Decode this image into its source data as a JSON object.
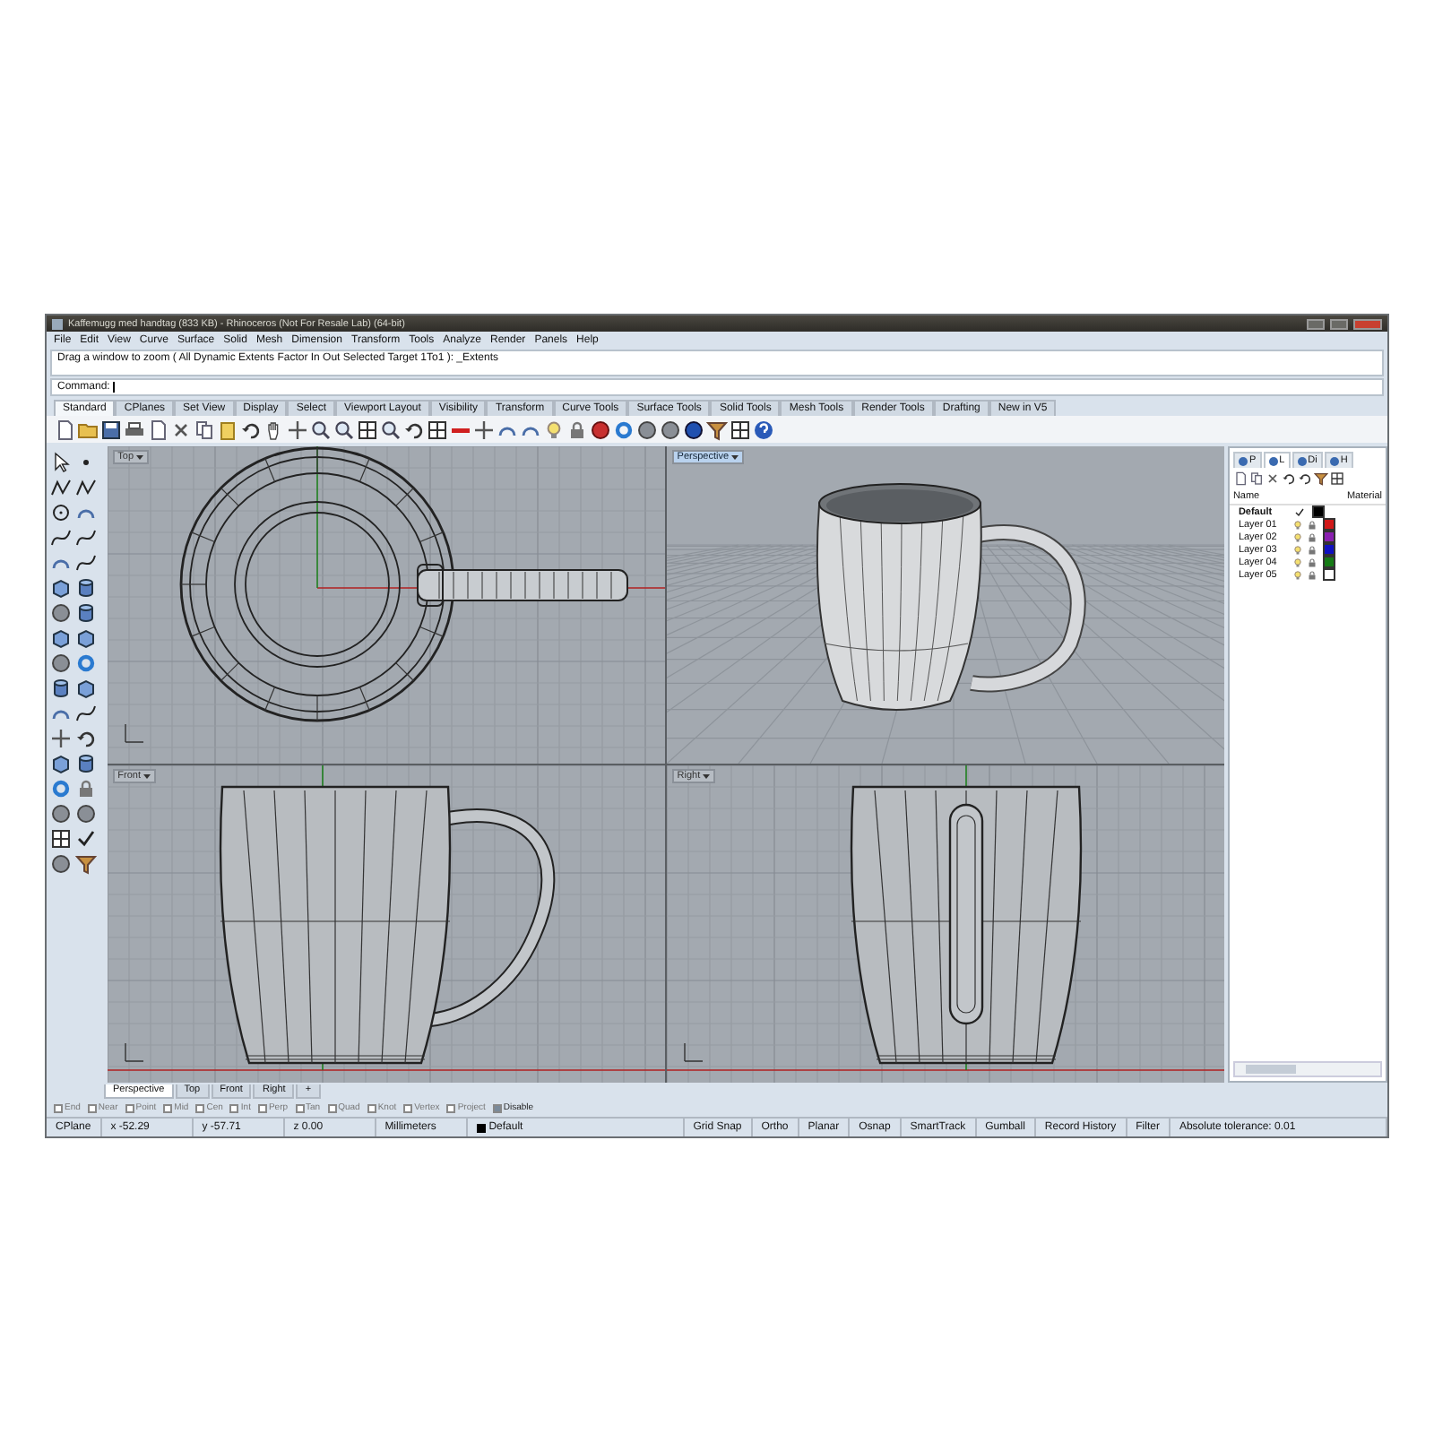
{
  "window": {
    "title": "Kaffemugg med handtag (833 KB) - Rhinoceros (Not For Resale Lab) (64-bit)"
  },
  "menu": [
    "File",
    "Edit",
    "View",
    "Curve",
    "Surface",
    "Solid",
    "Mesh",
    "Dimension",
    "Transform",
    "Tools",
    "Analyze",
    "Render",
    "Panels",
    "Help"
  ],
  "command_history": "Drag a window to zoom ( All Dynamic Extents Factor In Out Selected Target 1To1 ): _Extents",
  "command_prompt": "Command:",
  "toolbar_tabs": [
    {
      "label": "Standard",
      "selected": true
    },
    {
      "label": "CPlanes",
      "selected": false
    },
    {
      "label": "Set View",
      "selected": false
    },
    {
      "label": "Display",
      "selected": false
    },
    {
      "label": "Select",
      "selected": false
    },
    {
      "label": "Viewport Layout",
      "selected": false
    },
    {
      "label": "Visibility",
      "selected": false
    },
    {
      "label": "Transform",
      "selected": false
    },
    {
      "label": "Curve Tools",
      "selected": false
    },
    {
      "label": "Surface Tools",
      "selected": false
    },
    {
      "label": "Solid Tools",
      "selected": false
    },
    {
      "label": "Mesh Tools",
      "selected": false
    },
    {
      "label": "Render Tools",
      "selected": false
    },
    {
      "label": "Drafting",
      "selected": false
    },
    {
      "label": "New in V5",
      "selected": false
    }
  ],
  "viewports": [
    {
      "label": "Top",
      "kind": "top",
      "active": false
    },
    {
      "label": "Perspective",
      "kind": "perspective",
      "active": true
    },
    {
      "label": "Front",
      "kind": "front",
      "active": false
    },
    {
      "label": "Right",
      "kind": "right",
      "active": false
    }
  ],
  "viewport_tabs": [
    {
      "label": "Perspective",
      "selected": true
    },
    {
      "label": "Top",
      "selected": false
    },
    {
      "label": "Front",
      "selected": false
    },
    {
      "label": "Right",
      "selected": false
    }
  ],
  "viewport_tab_add": "+",
  "osnaps": [
    {
      "label": "End",
      "checked": false
    },
    {
      "label": "Near",
      "checked": false
    },
    {
      "label": "Point",
      "checked": false
    },
    {
      "label": "Mid",
      "checked": false
    },
    {
      "label": "Cen",
      "checked": false
    },
    {
      "label": "Int",
      "checked": false
    },
    {
      "label": "Perp",
      "checked": false
    },
    {
      "label": "Tan",
      "checked": false
    },
    {
      "label": "Quad",
      "checked": false
    },
    {
      "label": "Knot",
      "checked": false
    },
    {
      "label": "Vertex",
      "checked": false
    },
    {
      "label": "Project",
      "checked": false
    }
  ],
  "osnap_disable": {
    "label": "Disable",
    "checked": true
  },
  "layers_panel": {
    "tabs": [
      {
        "label": "P",
        "selected": false
      },
      {
        "label": "L",
        "selected": true
      },
      {
        "label": "Di",
        "selected": false
      },
      {
        "label": "H",
        "selected": false
      }
    ],
    "columns": [
      "Name",
      "Material"
    ],
    "layers": [
      {
        "name": "Default",
        "current": true,
        "color": "#000000"
      },
      {
        "name": "Layer 01",
        "current": false,
        "color": "#d01818"
      },
      {
        "name": "Layer 02",
        "current": false,
        "color": "#8a1fb0"
      },
      {
        "name": "Layer 03",
        "current": false,
        "color": "#1010c0"
      },
      {
        "name": "Layer 04",
        "current": false,
        "color": "#157a15"
      },
      {
        "name": "Layer 05",
        "current": false,
        "color": "#ffffff"
      }
    ]
  },
  "status_bar": {
    "cplane": "CPlane",
    "x": "x -52.29",
    "y": "y -57.71",
    "z": "z 0.00",
    "units": "Millimeters",
    "layer": {
      "name": "Default",
      "color": "#000000"
    },
    "toggles": [
      "Grid Snap",
      "Ortho",
      "Planar",
      "Osnap",
      "SmartTrack",
      "Gumball",
      "Record History",
      "Filter"
    ],
    "tolerance": "Absolute tolerance: 0.01"
  }
}
